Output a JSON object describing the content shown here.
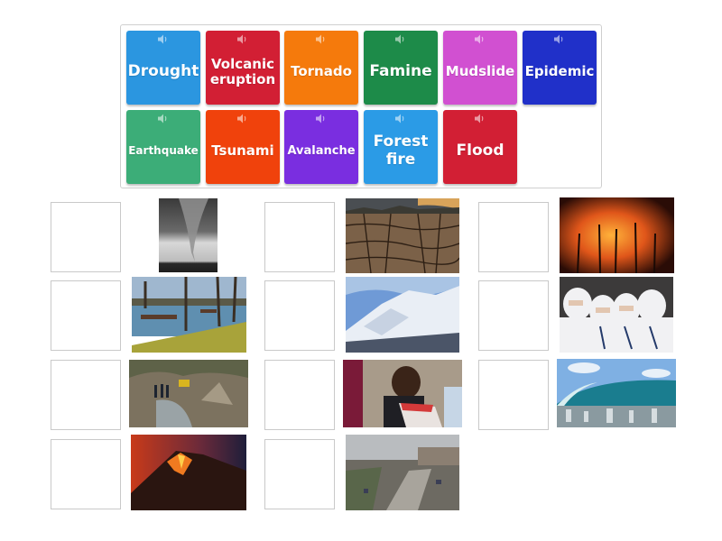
{
  "word_bank": {
    "tiles": [
      {
        "label": "Drought",
        "color": "#2b96e0",
        "size": "l"
      },
      {
        "label": "Volcanic eruption",
        "color": "#d21f34",
        "size": "m"
      },
      {
        "label": "Tornado",
        "color": "#f57a0c",
        "size": "m"
      },
      {
        "label": "Famine",
        "color": "#1d8b49",
        "size": "l"
      },
      {
        "label": "Mudslide",
        "color": "#d150d1",
        "size": "m"
      },
      {
        "label": "Epidemic",
        "color": "#2030c9",
        "size": "m"
      },
      {
        "label": "Earthquake",
        "color": "#3cad78",
        "size": "s"
      },
      {
        "label": "Tsunami",
        "color": "#f0420c",
        "size": "m"
      },
      {
        "label": "Avalanche",
        "color": "#7a2ee0",
        "size": "s2"
      },
      {
        "label": "Forest fire",
        "color": "#2b9be6",
        "size": "l"
      },
      {
        "label": "Flood",
        "color": "#d21f34",
        "size": "l"
      }
    ],
    "speaker_icon": "speaker-icon"
  },
  "match_items": [
    {
      "image": "tornado-photo",
      "slot": "empty"
    },
    {
      "image": "drought-photo",
      "slot": "empty"
    },
    {
      "image": "forest-fire-photo",
      "slot": "empty"
    },
    {
      "image": "flood-photo",
      "slot": "empty"
    },
    {
      "image": "avalanche-photo",
      "slot": "empty"
    },
    {
      "image": "epidemic-photo",
      "slot": "empty"
    },
    {
      "image": "mudslide-photo",
      "slot": "empty"
    },
    {
      "image": "famine-photo",
      "slot": "empty"
    },
    {
      "image": "tsunami-photo",
      "slot": "empty"
    },
    {
      "image": "volcanic-eruption-photo",
      "slot": "empty"
    },
    {
      "image": "earthquake-photo",
      "slot": "empty"
    }
  ]
}
